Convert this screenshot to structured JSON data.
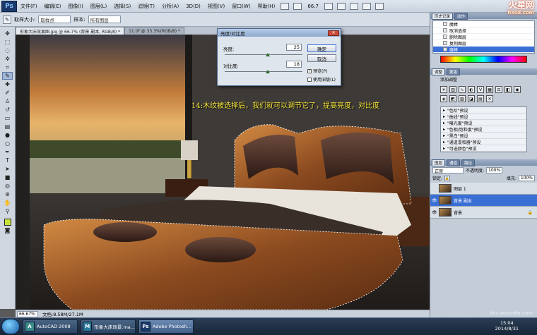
{
  "menubar": {
    "logo": "Ps",
    "items": [
      "文件(F)",
      "编辑(E)",
      "图像(I)",
      "图层(L)",
      "选择(S)",
      "滤镜(T)",
      "分析(A)",
      "3D(D)",
      "视图(V)",
      "窗口(W)",
      "帮助(H)"
    ],
    "zoom": "66.7"
  },
  "options": {
    "sample_size_label": "取样大小:",
    "sample_size_value": "取样点",
    "sample_label": "样本:",
    "sample_value": "所有图层"
  },
  "tabs": [
    {
      "label": "形象大床效果图.jpg @ 66.7% (背景 副本, RGB/8) *"
    },
    {
      "label": "11.tif @ 33.3%(RGB/8) *"
    }
  ],
  "status": {
    "zoom": "66.67%",
    "doc": "文档:8.58M/27.1M"
  },
  "dialog": {
    "title": "亮度/对比度",
    "brightness_label": "亮度:",
    "brightness_value": "25",
    "contrast_label": "对比度:",
    "contrast_value": "18",
    "brightness_level": 0.55,
    "contrast_level": 0.55,
    "ok": "确定",
    "cancel": "取消",
    "preview": "预览(P)",
    "legacy": "使用旧版(L)"
  },
  "annotation": "14:木纹被选择后，我们就可以调节它了，提高亮度，对比度",
  "history": {
    "tabs": [
      "历史记录",
      "动作"
    ],
    "items": [
      "魔棒",
      "取消选择",
      "删除图层",
      "复制图层",
      "魔棒"
    ],
    "selected": 4
  },
  "adjustments": {
    "tabs": [
      "调整",
      "蒙版"
    ],
    "title": "添加调整",
    "presets": [
      "\"色阶\"预设",
      "\"曲线\"预设",
      "\"曝光度\"预设",
      "\"色相/饱和度\"预设",
      "\"黑白\"预设",
      "\"通道混和器\"预设",
      "\"可选颜色\"预设"
    ]
  },
  "layers": {
    "tabs": [
      "图层",
      "通道",
      "路径"
    ],
    "blend": "正常",
    "opacity_label": "不透明度:",
    "opacity": "100%",
    "lock_label": "锁定:",
    "fill_label": "填充:",
    "fill": "100%",
    "rows": [
      {
        "name": "图层 1",
        "selected": false
      },
      {
        "name": "背景 副本",
        "selected": true
      },
      {
        "name": "背景",
        "selected": false
      }
    ]
  },
  "taskbar": {
    "tasks": [
      "AutoCAD 2008",
      "形象大床场景.ma...",
      "Adobe Photosh..."
    ],
    "time": "15:04",
    "date": "2014/8/31"
  },
  "watermark": {
    "brand": "火星网",
    "url": "hxsd.com",
    "footer": "bbs.wxonder.com"
  }
}
